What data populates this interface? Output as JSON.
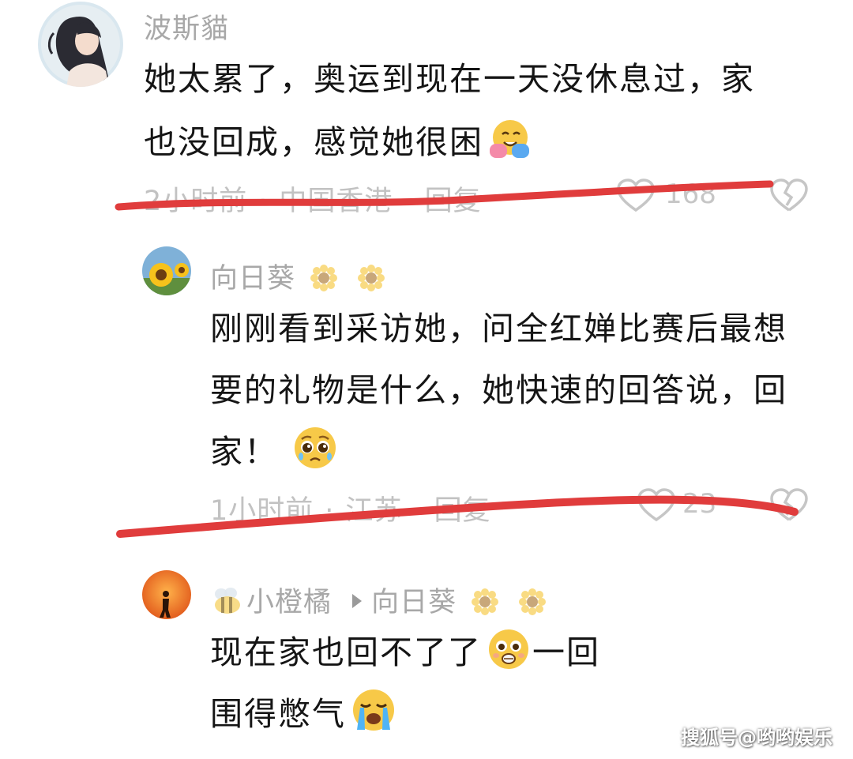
{
  "comments": [
    {
      "username": "波斯貓",
      "text_line1": "她太累了，奥运到现在一天没休息过，家",
      "text_line2": "也没回成，感觉她很困",
      "emoji": "hugging-face-emoji",
      "time": "2小时前",
      "location": "中国香港",
      "reply_label": "回复",
      "likes": "168"
    },
    {
      "username": "向日葵",
      "name_emoji": "sunflower-emoji",
      "text_line1": "刚刚看到采访她，问全红婵比赛后最想",
      "text_line2": "要的礼物是什么，她快速的回答说，回",
      "text_line3": "家！",
      "emoji": "pleading-face-emoji",
      "time": "1小时前",
      "location": "江苏",
      "reply_label": "回复",
      "likes": "23"
    },
    {
      "username": "小橙橘",
      "reply_to": "向日葵",
      "name_emoji": "bee-emoji",
      "text_line1": "现在家也回不了了",
      "text_line1_tail": "一回",
      "text_line2": "围得憋气",
      "emoji1": "anxious-face-emoji",
      "emoji2": "crying-face-emoji"
    }
  ],
  "watermark": "搜狐号@哟哟娱乐",
  "colors": {
    "strike": "#e03c3c",
    "username": "#a8a8a8",
    "meta": "#c2c2c2",
    "text": "#151515"
  }
}
